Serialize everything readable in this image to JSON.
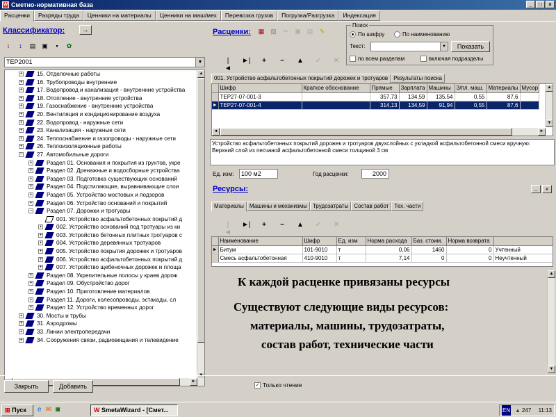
{
  "window": {
    "title": "Сметно-нормативная база"
  },
  "top_tabs": [
    "Расценки",
    "Разряды труда",
    "Ценники на материалы",
    "Ценники на маш/мех",
    "Перевозка грузов",
    "Погрузка/Разгрузка",
    "Индексация"
  ],
  "left": {
    "header": "Классификатор:",
    "arrow_button": "→",
    "combo_value": "TEP2001",
    "tree": [
      {
        "level": 1,
        "text": "15. Отделочные работы",
        "exp": "+"
      },
      {
        "level": 1,
        "text": "16. Трубопроводы внутренние",
        "exp": "+"
      },
      {
        "level": 1,
        "text": "17. Водопровод и канализация - внутренние устройства",
        "exp": "+"
      },
      {
        "level": 1,
        "text": "18. Отопление - внутренние устройства",
        "exp": "+"
      },
      {
        "level": 1,
        "text": "19. Газоснабжение - внутренние устройства",
        "exp": "+"
      },
      {
        "level": 1,
        "text": "20. Вентиляция и кондиционирование воздуха",
        "exp": "+"
      },
      {
        "level": 1,
        "text": "22. Водопровод - наружные сети",
        "exp": "+"
      },
      {
        "level": 1,
        "text": "23. Канализация - наружные сети",
        "exp": "+"
      },
      {
        "level": 1,
        "text": "24. Теплоснабжение и газопроводы - наружные сети",
        "exp": "+"
      },
      {
        "level": 1,
        "text": "26. Теплоизоляционные работы",
        "exp": "+"
      },
      {
        "level": 1,
        "text": "27. Автомобильные дороги",
        "exp": "−"
      },
      {
        "level": 2,
        "text": "Раздел 01. Основания и покрытия из грунтов, укре",
        "exp": "+"
      },
      {
        "level": 2,
        "text": "Раздел 02. Дренажные и водосборные устройства",
        "exp": "+"
      },
      {
        "level": 2,
        "text": "Раздел 03. Подготовка существующих оснований",
        "exp": "+"
      },
      {
        "level": 2,
        "text": "Раздел 04. Подстилающие, выравнивающие слои",
        "exp": "+"
      },
      {
        "level": 2,
        "text": "Раздел 05. Устройство мостовых и подзоров",
        "exp": "+"
      },
      {
        "level": 2,
        "text": "Раздел 06. Устройство оснований и покрытий",
        "exp": "+"
      },
      {
        "level": 2,
        "text": "Раздел 07. Дорожки и тротуары",
        "exp": "−"
      },
      {
        "level": 3,
        "text": "001. Устройство асфальтобетонных покрытий д",
        "exp": "",
        "open": true
      },
      {
        "level": 3,
        "text": "002. Устройство оснований под тротуары из ки",
        "exp": "+"
      },
      {
        "level": 3,
        "text": "003. Устройство бетонных плитных тротуаров с",
        "exp": "+"
      },
      {
        "level": 3,
        "text": "004. Устройство деревянных тротуаров",
        "exp": "+"
      },
      {
        "level": 3,
        "text": "005. Устройство покрытия дорожек и тротуаров",
        "exp": "+"
      },
      {
        "level": 3,
        "text": "006. Устройство асфальтобетонных покрытий д",
        "exp": "+"
      },
      {
        "level": 3,
        "text": "007. Устройство щебеночных дорожек и площа",
        "exp": "+"
      },
      {
        "level": 2,
        "text": "Раздел 08. Укрепительные полосы у краев дорож",
        "exp": "+"
      },
      {
        "level": 2,
        "text": "Раздел 09. Обустройство дорог",
        "exp": "+"
      },
      {
        "level": 2,
        "text": "Раздел 10. Приготовление материалов",
        "exp": "+"
      },
      {
        "level": 2,
        "text": "Раздел 11. Дороги, колесопроводы, эстакады, сл",
        "exp": "+"
      },
      {
        "level": 2,
        "text": "Раздел 12. Устройство временных дорог",
        "exp": "+"
      },
      {
        "level": 1,
        "text": "30. Мосты и трубы",
        "exp": "+"
      },
      {
        "level": 1,
        "text": "31. Аэродромы",
        "exp": "+"
      },
      {
        "level": 1,
        "text": "33. Линии электропередачи",
        "exp": "+"
      },
      {
        "level": 1,
        "text": "34. Сооружения связи, радиовещания и телевидение",
        "exp": "+"
      }
    ]
  },
  "rates": {
    "header": "Расценки:",
    "search": {
      "group_label": "Поиск",
      "radio1": "По шифру",
      "radio2": "По наименованию",
      "text_label": "Текст:",
      "show_button": "Показать",
      "chk1": "по всем разделам",
      "chk2": "включая подразделы"
    },
    "tab1": "001. Устройство асфальтобетонных покрытий дорожек и тротуаров",
    "tab2": "Результаты поиска",
    "columns": [
      "Шифр",
      "Краткое обоснование",
      "Прямые",
      "Зарплата",
      "Машины",
      "З/пл. маш.",
      "Материалы",
      "Мусор"
    ],
    "rows": [
      [
        "ТЕР27-07-001-3",
        "",
        "357,73",
        "134,59",
        "135,54",
        "0,55",
        "87,6",
        ""
      ],
      [
        "ТЕР27-07-001-4",
        "",
        "314,13",
        "134,59",
        "91,94",
        "0,55",
        "87,6",
        ""
      ]
    ],
    "description": "Устройство асфальтобетонных покрытий дорожек и тротуаров двухслойных с укладкой асфальтобетонной смеси вручную: Верхний слой из песчаной асфальтобетонной смеси толщиной 3 см",
    "unit_label": "Ед. изм:",
    "unit_value": "100 м2",
    "year_label": "Год расценки:",
    "year_value": "2000"
  },
  "resources": {
    "header": "Ресурсы:",
    "tabs": [
      "Материалы",
      "Машины и механизмы",
      "Трудозатраты",
      "Состав работ",
      "Тех. части"
    ],
    "columns": [
      "Наименование",
      "Шифр",
      "Ед. изм",
      "Норма расхода",
      "Баз. стоим.",
      "Норма возврата",
      ""
    ],
    "rows": [
      [
        "Битум",
        "101-9010",
        "т",
        "0,06",
        "1460",
        "0",
        "Учтенный"
      ],
      [
        "Смесь асфальтобетонная",
        "410-9010",
        "т",
        "7,14",
        "0",
        "0",
        "Неучтенный"
      ]
    ]
  },
  "overlay": {
    "line1": "К каждой расценке привязаны ресурсы",
    "line2": "Существуют следующие виды ресурсов:",
    "line3": "материалы,  машины, трудозатраты,",
    "line4": "состав работ,  технические части"
  },
  "bottom": {
    "close_button": "Закрыть",
    "add_button": "Добавить",
    "readonly_label": "Только чтение"
  },
  "taskbar": {
    "start": "Пуск",
    "task": "SmetaWizard - [Смет...",
    "tray_lang": "EN",
    "tray_num": "247",
    "clock": "11:13"
  }
}
